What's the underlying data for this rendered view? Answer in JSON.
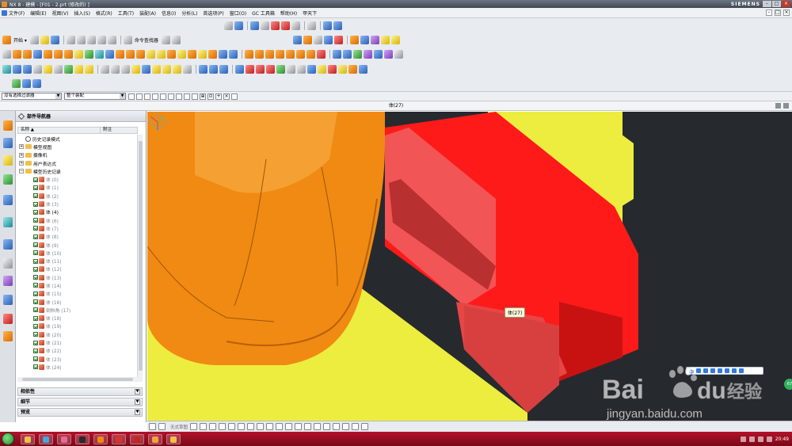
{
  "window": {
    "title": "NX 8 - 建模 - [F01 - 2.prt  (修改的) ]",
    "brand": "SIEMENS",
    "controls": [
      "–",
      "□",
      "×"
    ]
  },
  "menubar": {
    "items": [
      "文件(F)",
      "编辑(E)",
      "视图(V)",
      "插入(S)",
      "格式(R)",
      "工具(T)",
      "装配(A)",
      "信息(I)",
      "分析(L)",
      "首选项(P)",
      "窗口(O)",
      "GC 工具箱",
      "帮助(H)",
      "甲天下"
    ]
  },
  "toolbar": {
    "start_label": "开始 ▾",
    "command_finder_label": "命令查找器"
  },
  "selection_bar": {
    "filter_value": "没有选择过滤器",
    "scope_value": "整个装配"
  },
  "status": {
    "center_text": "体(27)"
  },
  "navigator": {
    "title": "部件导航器",
    "col_name": "名称",
    "col_note": "附注",
    "tree": [
      {
        "label": "历史记录模式",
        "level": 0,
        "type": "clock",
        "dim": false
      },
      {
        "label": "模型视图",
        "level": 0,
        "type": "folder-exp",
        "dim": false
      },
      {
        "label": "摄像机",
        "level": 0,
        "type": "folder-exp",
        "dim": false
      },
      {
        "label": "用户表达式",
        "level": 0,
        "type": "folder-exp",
        "dim": false
      },
      {
        "label": "模型历史记录",
        "level": 0,
        "type": "folder-open",
        "dim": false
      },
      {
        "label": "体 (0)",
        "level": 1,
        "type": "feat",
        "dim": true
      },
      {
        "label": "体 (1)",
        "level": 1,
        "type": "feat",
        "dim": true
      },
      {
        "label": "体 (2)",
        "level": 1,
        "type": "feat",
        "dim": true
      },
      {
        "label": "体 (3)",
        "level": 1,
        "type": "feat",
        "dim": true
      },
      {
        "label": "体 (4)",
        "level": 1,
        "type": "feat",
        "dim": false
      },
      {
        "label": "体 (6)",
        "level": 1,
        "type": "feat",
        "dim": true
      },
      {
        "label": "体 (7)",
        "level": 1,
        "type": "feat",
        "dim": true
      },
      {
        "label": "体 (8)",
        "level": 1,
        "type": "feat",
        "dim": true
      },
      {
        "label": "体 (9)",
        "level": 1,
        "type": "feat",
        "dim": true
      },
      {
        "label": "体 (10)",
        "level": 1,
        "type": "feat",
        "dim": true
      },
      {
        "label": "体 (11)",
        "level": 1,
        "type": "feat",
        "dim": true
      },
      {
        "label": "体 (12)",
        "level": 1,
        "type": "feat",
        "dim": true
      },
      {
        "label": "体 (13)",
        "level": 1,
        "type": "feat",
        "dim": true
      },
      {
        "label": "体 (14)",
        "level": 1,
        "type": "feat",
        "dim": true
      },
      {
        "label": "体 (15)",
        "level": 1,
        "type": "feat",
        "dim": true
      },
      {
        "label": "体 (16)",
        "level": 1,
        "type": "feat",
        "dim": true
      },
      {
        "label": "倒斜角 (17)",
        "level": 1,
        "type": "feat",
        "dim": true
      },
      {
        "label": "体 (18)",
        "level": 1,
        "type": "feat",
        "dim": true
      },
      {
        "label": "体 (19)",
        "level": 1,
        "type": "feat",
        "dim": true
      },
      {
        "label": "体 (20)",
        "level": 1,
        "type": "feat",
        "dim": true
      },
      {
        "label": "体 (21)",
        "level": 1,
        "type": "feat",
        "dim": true
      },
      {
        "label": "体 (22)",
        "level": 1,
        "type": "feat",
        "dim": true
      },
      {
        "label": "体 (23)",
        "level": 1,
        "type": "feat",
        "dim": true
      },
      {
        "label": "体 (24)",
        "level": 1,
        "type": "feat",
        "dim": true
      }
    ],
    "panels": [
      "相依性",
      "细节",
      "预览"
    ]
  },
  "viewport": {
    "tooltip": "体(27)",
    "colors": {
      "background": "#262a2f",
      "yellow_body": "#eded3f",
      "orange_body": "#f08a12",
      "red_body": "#ff1a1a",
      "highlight_body": "#f25555"
    }
  },
  "sketch_toolbar": {
    "label": "无式草图"
  },
  "watermark": {
    "brand_latin": "Bai",
    "brand_tail": "du",
    "brand_cn": "经验",
    "url": "jingyan.baidu.com"
  },
  "ime": {
    "label": "中"
  },
  "side_badge": "67",
  "taskbar": {
    "clock": "20:49",
    "icons": [
      "start",
      "explorer",
      "browser",
      "paint",
      "media",
      "player",
      "chrome",
      "pdf",
      "nx",
      "folder"
    ]
  }
}
